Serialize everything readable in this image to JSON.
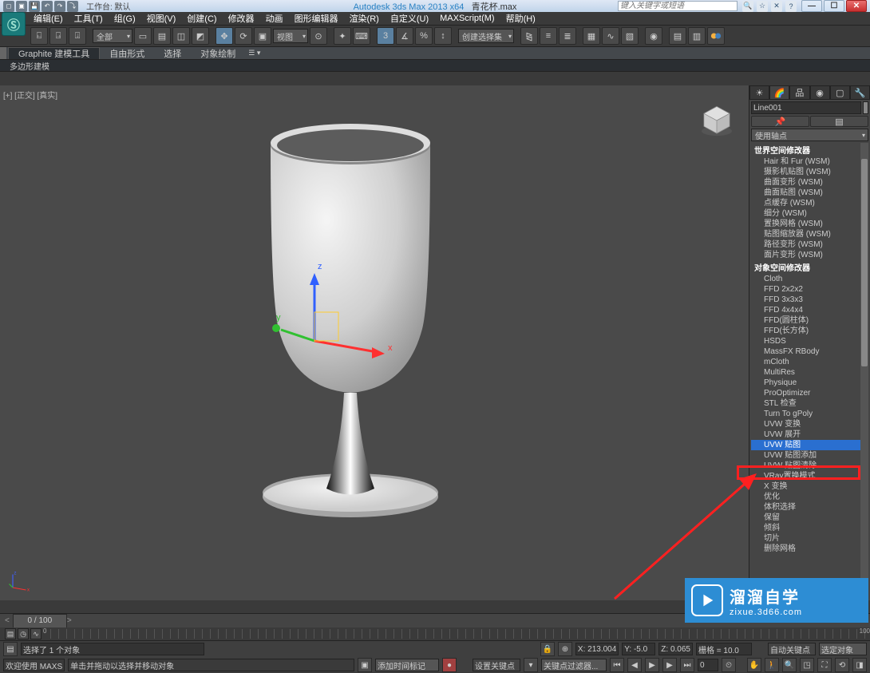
{
  "title": {
    "app": "Autodesk 3ds Max  2013 x64",
    "file": "青花杯.max",
    "workspace_lbl": "工作台: 默认"
  },
  "search_placeholder": "键入关键字或短语",
  "menus": [
    "编辑(E)",
    "工具(T)",
    "组(G)",
    "视图(V)",
    "创建(C)",
    "修改器",
    "动画",
    "图形编辑器",
    "渲染(R)",
    "自定义(U)",
    "MAXScript(M)",
    "帮助(H)"
  ],
  "toolbar_dd": {
    "all": "全部",
    "view": "视图",
    "createsel": "创建选择集"
  },
  "ribbon": {
    "tabs": [
      "Graphite 建模工具",
      "自由形式",
      "选择",
      "对象绘制"
    ],
    "sub": "多边形建模"
  },
  "viewport_label": "[+] [正交] [真实]",
  "cmd": {
    "obj_name": "Line001",
    "modlist_label": "使用轴点",
    "h1": "世界空间修改器",
    "wsm": [
      "Hair 和 Fur (WSM)",
      "摄影机贴图 (WSM)",
      "曲面变形 (WSM)",
      "曲面贴图 (WSM)",
      "点缓存 (WSM)",
      "细分 (WSM)",
      "置换网格 (WSM)",
      "贴图缩放器 (WSM)",
      "路径变形 (WSM)",
      "面片变形 (WSM)"
    ],
    "h2": "对象空间修改器",
    "osm": [
      "Cloth",
      "FFD 2x2x2",
      "FFD 3x3x3",
      "FFD 4x4x4",
      "FFD(圆柱体)",
      "FFD(长方体)",
      "HSDS",
      "MassFX RBody",
      "mCloth",
      "MultiRes",
      "Physique",
      "ProOptimizer",
      "STL 检查",
      "Turn To gPoly",
      "UVW 变换",
      "UVW 展开",
      "UVW 贴图",
      "UVW 贴图添加",
      "UVW 贴图清除",
      "VRay置换模式",
      "X 变换",
      "优化",
      "体积选择",
      "保留",
      "倾斜",
      "切片",
      "删除网格"
    ]
  },
  "timeline": {
    "pos": "0 / 100"
  },
  "status": {
    "sel": "选择了 1 个对象",
    "x": "X: 213.004",
    "y": "Y: -5.0",
    "z": "Z: 0.065",
    "grid": "栅格 = 10.0",
    "autokey": "自动关键点",
    "setkey": "设置关键点",
    "selset": "选定对象",
    "keyfilter": "关键点过滤器...",
    "welcome": "欢迎使用 MAXS",
    "hint": "单击并拖动以选择并移动对象",
    "addtime": "添加时间标记"
  },
  "watermark": {
    "l1": "溜溜自学",
    "l2": "zixue.3d66.com"
  }
}
